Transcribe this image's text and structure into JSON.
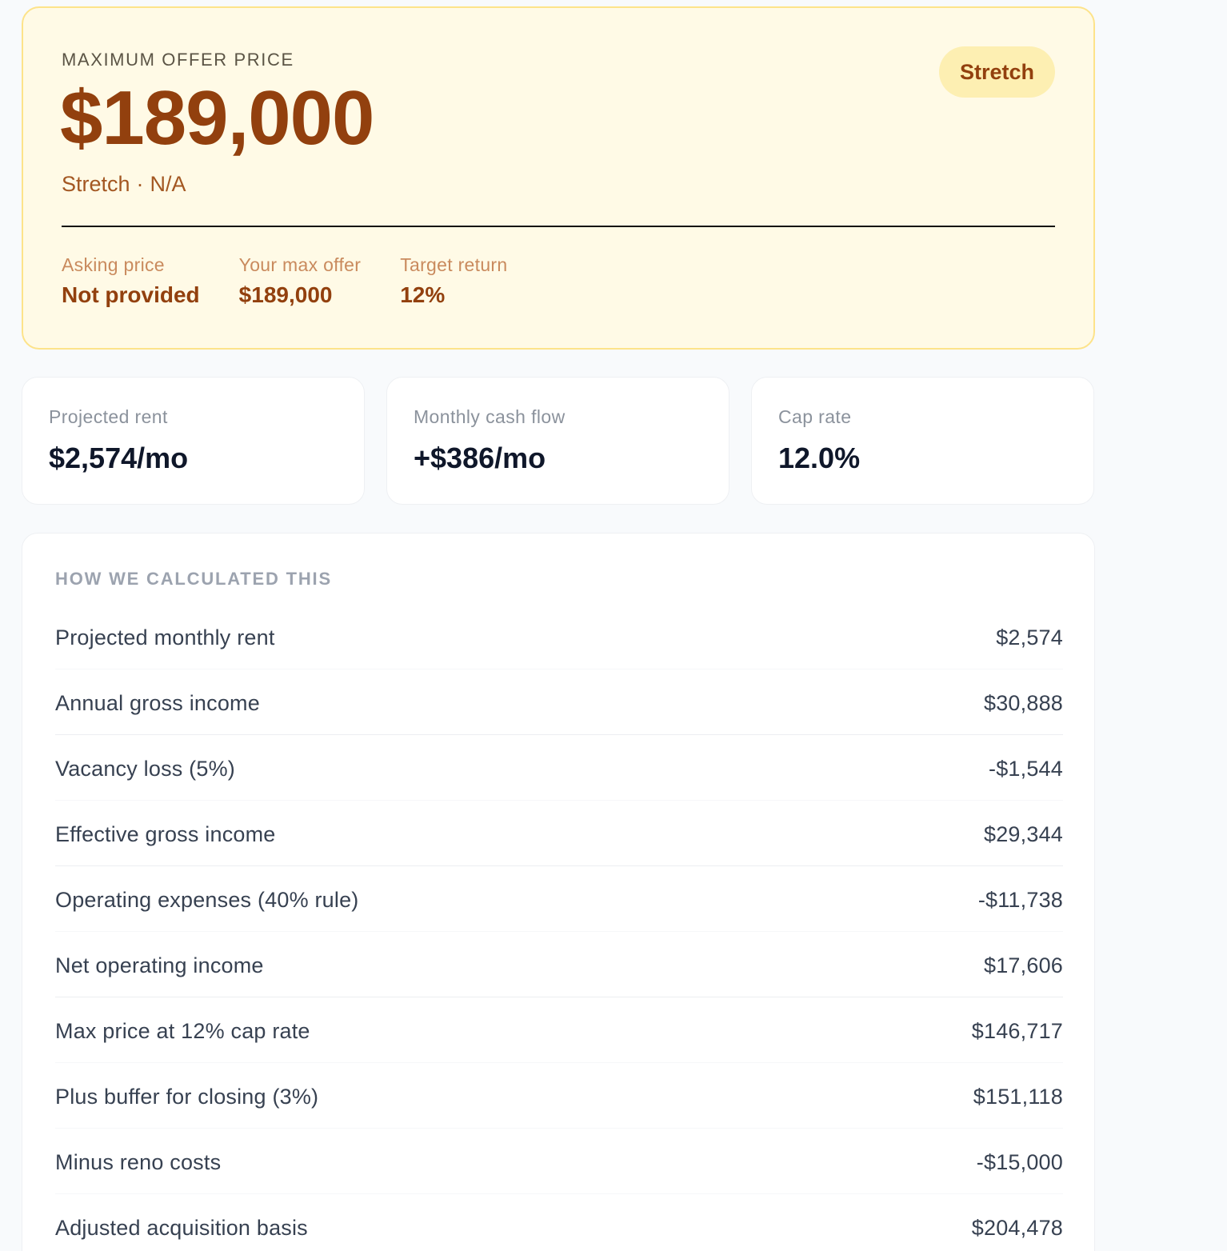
{
  "offer": {
    "eyebrow": "MAXIMUM OFFER PRICE",
    "price": "$189,000",
    "subline_tier": "Stretch",
    "subline_separator": "·",
    "subline_detail": "N/A",
    "badge": "Stretch",
    "stats": [
      {
        "label": "Asking price",
        "value": "Not provided"
      },
      {
        "label": "Your max offer",
        "value": "$189,000"
      },
      {
        "label": "Target return",
        "value": "12%"
      }
    ]
  },
  "metrics": [
    {
      "label": "Projected rent",
      "value": "$2,574/mo"
    },
    {
      "label": "Monthly cash flow",
      "value": "+$386/mo"
    },
    {
      "label": "Cap rate",
      "value": "12.0%"
    }
  ],
  "calculation": {
    "heading": "HOW WE CALCULATED THIS",
    "rows": [
      {
        "label": "Projected monthly rent",
        "value": "$2,574"
      },
      {
        "label": "Annual gross income",
        "value": "$30,888"
      },
      {
        "label": "Vacancy loss (5%)",
        "value": "-$1,544"
      },
      {
        "label": "Effective gross income",
        "value": "$29,344"
      },
      {
        "label": "Operating expenses (40% rule)",
        "value": "-$11,738"
      },
      {
        "label": "Net operating income",
        "value": "$17,606"
      },
      {
        "label": "Max price at 12% cap rate",
        "value": "$146,717"
      },
      {
        "label": "Plus buffer for closing (3%)",
        "value": "$151,118"
      },
      {
        "label": "Minus reno costs",
        "value": "-$15,000"
      },
      {
        "label": "Adjusted acquisition basis",
        "value": "$204,478"
      }
    ]
  },
  "colors": {
    "accent": "#92400e",
    "card_bg": "#fffae6",
    "card_border": "#fde38a",
    "badge_bg": "#fdefb2"
  }
}
